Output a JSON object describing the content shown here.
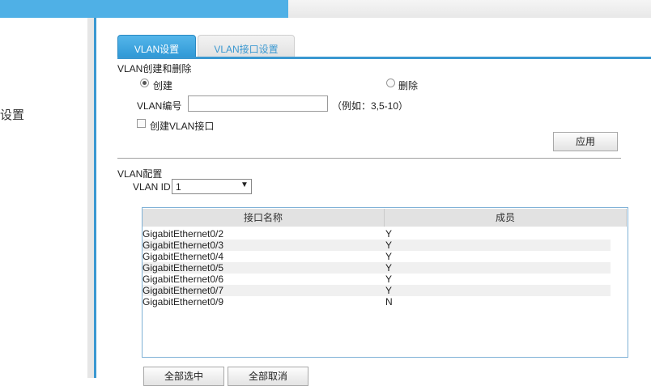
{
  "sidebar": {
    "label": "设置"
  },
  "tabs": [
    {
      "label": "VLAN设置",
      "active": true
    },
    {
      "label": "VLAN接口设置",
      "active": false
    }
  ],
  "create_delete": {
    "section_title": "VLAN创建和删除",
    "radio_create": "创建",
    "radio_delete": "删除",
    "selected": "创建",
    "vlan_id_label": "VLAN编号",
    "vlan_id_value": "",
    "example_hint": "（例如：3,5-10）",
    "create_interface_label": "创建VLAN接口",
    "create_interface_checked": false,
    "apply_label": "应用"
  },
  "config": {
    "section_title": "VLAN配置",
    "vlan_id_label": "VLAN ID",
    "vlan_id_value": "1"
  },
  "table": {
    "headers": [
      "接口名称",
      "成员"
    ],
    "rows": [
      {
        "name": "GigabitEthernet0/2",
        "member": "Y"
      },
      {
        "name": "GigabitEthernet0/3",
        "member": "Y"
      },
      {
        "name": "GigabitEthernet0/4",
        "member": "Y"
      },
      {
        "name": "GigabitEthernet0/5",
        "member": "Y"
      },
      {
        "name": "GigabitEthernet0/6",
        "member": "Y"
      },
      {
        "name": "GigabitEthernet0/7",
        "member": "Y"
      },
      {
        "name": "GigabitEthernet0/9",
        "member": "N"
      }
    ]
  },
  "actions": {
    "select_all_label": "全部选中",
    "deselect_all_label": "全部取消"
  },
  "colors": {
    "accent": "#3a98d1",
    "tab_active": "#4fb0e6"
  }
}
